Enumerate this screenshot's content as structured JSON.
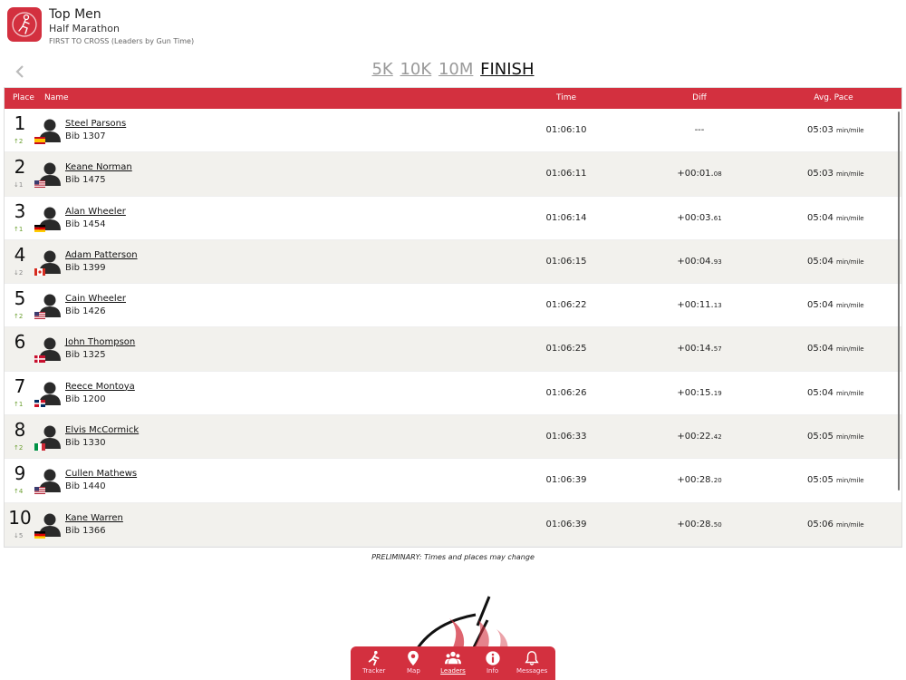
{
  "header": {
    "title": "Top Men",
    "subtitle": "Half Marathon",
    "caption": "FIRST TO CROSS (Leaders by Gun Time)"
  },
  "splits": [
    "5K",
    "10K",
    "10M",
    "FINISH"
  ],
  "active_split": "FINISH",
  "columns": {
    "place": "Place",
    "name": "Name",
    "time": "Time",
    "diff": "Diff",
    "pace": "Avg. Pace"
  },
  "pace_unit": "min/mile",
  "rows": [
    {
      "place": "1",
      "move": "↑2",
      "dir": "up",
      "name": "Steel Parsons",
      "bib": "Bib 1307",
      "time": "01:06:10",
      "diff": "---",
      "diff_frac": "",
      "pace": "05:03",
      "flag": "spain"
    },
    {
      "place": "2",
      "move": "↓1",
      "dir": "down",
      "name": "Keane Norman",
      "bib": "Bib 1475",
      "time": "01:06:11",
      "diff": "+00:01.",
      "diff_frac": "08",
      "pace": "05:03",
      "flag": "usa"
    },
    {
      "place": "3",
      "move": "↑1",
      "dir": "up",
      "name": "Alan Wheeler",
      "bib": "Bib 1454",
      "time": "01:06:14",
      "diff": "+00:03.",
      "diff_frac": "61",
      "pace": "05:04",
      "flag": "germany"
    },
    {
      "place": "4",
      "move": "↓2",
      "dir": "down",
      "name": "Adam Patterson",
      "bib": "Bib 1399",
      "time": "01:06:15",
      "diff": "+00:04.",
      "diff_frac": "93",
      "pace": "05:04",
      "flag": "canada"
    },
    {
      "place": "5",
      "move": "↑2",
      "dir": "up",
      "name": "Cain Wheeler",
      "bib": "Bib 1426",
      "time": "01:06:22",
      "diff": "+00:11.",
      "diff_frac": "13",
      "pace": "05:04",
      "flag": "usa"
    },
    {
      "place": "6",
      "move": "",
      "dir": "none",
      "name": "John Thompson",
      "bib": "Bib 1325",
      "time": "01:06:25",
      "diff": "+00:14.",
      "diff_frac": "57",
      "pace": "05:04",
      "flag": "denmark"
    },
    {
      "place": "7",
      "move": "↑1",
      "dir": "up",
      "name": "Reece Montoya",
      "bib": "Bib 1200",
      "time": "01:06:26",
      "diff": "+00:15.",
      "diff_frac": "19",
      "pace": "05:04",
      "flag": "dominican"
    },
    {
      "place": "8",
      "move": "↑2",
      "dir": "up",
      "name": "Elvis McCormick",
      "bib": "Bib 1330",
      "time": "01:06:33",
      "diff": "+00:22.",
      "diff_frac": "42",
      "pace": "05:05",
      "flag": "italy"
    },
    {
      "place": "9",
      "move": "↑4",
      "dir": "up",
      "name": "Cullen Mathews",
      "bib": "Bib 1440",
      "time": "01:06:39",
      "diff": "+00:28.",
      "diff_frac": "20",
      "pace": "05:05",
      "flag": "usa"
    },
    {
      "place": "10",
      "move": "↓5",
      "dir": "down",
      "name": "Kane Warren",
      "bib": "Bib 1366",
      "time": "01:06:39",
      "diff": "+00:28.",
      "diff_frac": "50",
      "pace": "05:06",
      "flag": "germany"
    }
  ],
  "footnote": "PRELIMINARY: Times and places may change",
  "tabs": [
    {
      "label": "Tracker",
      "icon": "runner-icon"
    },
    {
      "label": "Map",
      "icon": "map-pin-icon"
    },
    {
      "label": "Leaders",
      "icon": "group-icon"
    },
    {
      "label": "Info",
      "icon": "info-icon"
    },
    {
      "label": "Messages",
      "icon": "bell-icon"
    }
  ],
  "active_tab": "Leaders",
  "colors": {
    "accent": "#d3303f",
    "row_alt": "#f2f1ed",
    "up": "#6a9e2e"
  }
}
